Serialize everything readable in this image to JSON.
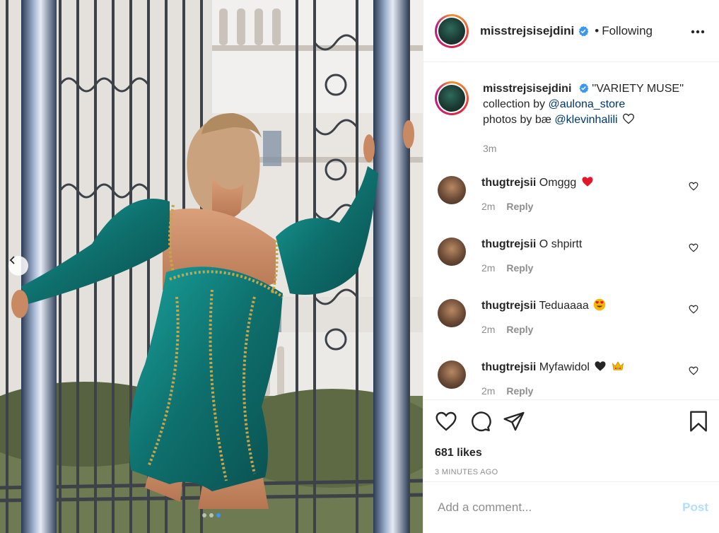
{
  "post": {
    "username": "misstrejsisejdini",
    "follow_status": "Following",
    "bullet": "•",
    "caption_text_1": "''VARIETY MUSE''",
    "caption_text_2": "collection by",
    "caption_mention_1": "@aulona_store",
    "caption_text_3": "photos by bæ",
    "caption_mention_2": "@klevinhalili",
    "caption_time": "3m"
  },
  "comments": [
    {
      "username": "thugtrejsii",
      "text": "Omggg",
      "emoji": "red-heart",
      "time": "2m",
      "reply_label": "Reply"
    },
    {
      "username": "thugtrejsii",
      "text": "O shpirtt",
      "emoji": "",
      "time": "2m",
      "reply_label": "Reply"
    },
    {
      "username": "thugtrejsii",
      "text": "Teduaaaa",
      "emoji": "heart-eyes",
      "time": "2m",
      "reply_label": "Reply"
    },
    {
      "username": "thugtrejsii",
      "text": "Myfawidol",
      "emoji": "black-heart-crown",
      "time": "2m",
      "reply_label": "Reply"
    }
  ],
  "actions": {
    "likes": "681 likes",
    "time_ago": "3 MINUTES AGO"
  },
  "add_comment": {
    "placeholder": "Add a comment...",
    "post_label": "Post"
  },
  "carousel": {
    "count": 3,
    "active_index": 2
  },
  "colors": {
    "text": "#262626",
    "muted": "#8e8e8e",
    "link": "#00376b",
    "verified": "#3897f0",
    "post_disabled": "#b2dffc",
    "dress": "#0f7a78"
  },
  "icons": [
    "verified-badge-icon",
    "more-options-icon",
    "heart-icon",
    "comment-icon",
    "share-icon",
    "bookmark-icon",
    "chevron-left-icon"
  ]
}
